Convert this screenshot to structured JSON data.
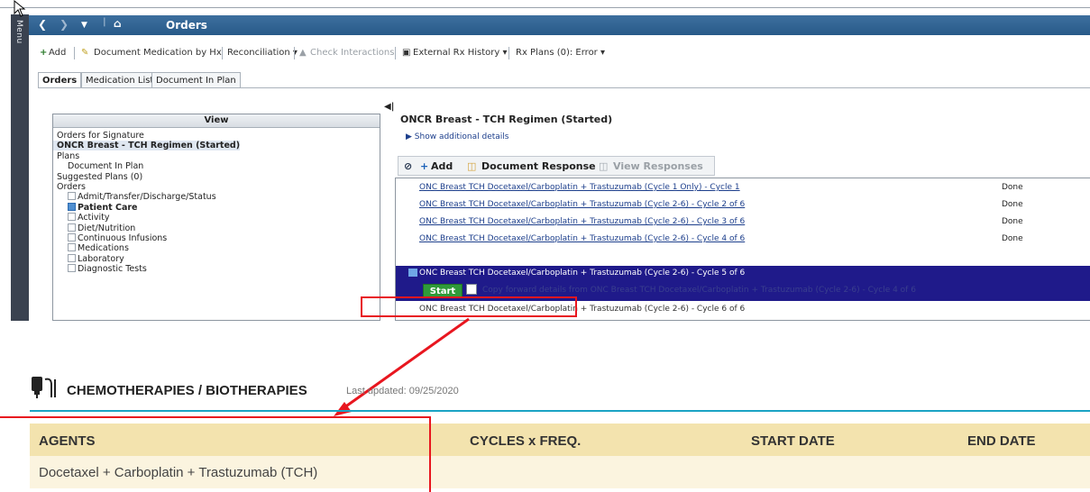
{
  "app": {
    "menu_label": "Menu",
    "window_title": "Orders",
    "toolbar": {
      "add": "Add",
      "document_medication": "Document Medication by Hx",
      "reconciliation": "Reconciliation ▾",
      "check_interactions": "Check Interactions",
      "external_rx": "External Rx History ▾",
      "rx_plans": "Rx Plans (0): Error ▾"
    },
    "tabs": [
      "Orders",
      "Medication List",
      "Document In Plan"
    ],
    "tree": {
      "header": "View",
      "items": [
        {
          "label": "Orders for Signature",
          "indent": 0,
          "bold": false,
          "checkbox": false
        },
        {
          "label": "ONCR Breast - TCH Regimen (Started)",
          "indent": 0,
          "bold": true,
          "checkbox": false
        },
        {
          "label": "Plans",
          "indent": 0,
          "bold": false,
          "checkbox": false
        },
        {
          "label": "Document In Plan",
          "indent": 1,
          "bold": false,
          "checkbox": false
        },
        {
          "label": "Suggested Plans (0)",
          "indent": 0,
          "bold": false,
          "checkbox": false
        },
        {
          "label": "Orders",
          "indent": 0,
          "bold": false,
          "checkbox": false
        },
        {
          "label": "Admit/Transfer/Discharge/Status",
          "indent": 1,
          "bold": false,
          "checkbox": true,
          "checked": false
        },
        {
          "label": "Patient Care",
          "indent": 1,
          "bold": true,
          "checkbox": true,
          "checked": true
        },
        {
          "label": "Activity",
          "indent": 1,
          "bold": false,
          "checkbox": true,
          "checked": false
        },
        {
          "label": "Diet/Nutrition",
          "indent": 1,
          "bold": false,
          "checkbox": true,
          "checked": false
        },
        {
          "label": "Continuous Infusions",
          "indent": 1,
          "bold": false,
          "checkbox": true,
          "checked": false
        },
        {
          "label": "Medications",
          "indent": 1,
          "bold": false,
          "checkbox": true,
          "checked": false
        },
        {
          "label": "Laboratory",
          "indent": 1,
          "bold": false,
          "checkbox": true,
          "checked": false
        },
        {
          "label": "Diagnostic Tests",
          "indent": 1,
          "bold": false,
          "checkbox": true,
          "checked": false
        }
      ]
    },
    "plan": {
      "title": "ONCR Breast - TCH Regimen (Started)",
      "show_details": "Show additional details",
      "toolbar_add": "Add",
      "toolbar_document_response": "Document Response",
      "toolbar_view_responses": "View Responses",
      "phases": [
        {
          "label": "ONC Breast TCH Docetaxel/Carboplatin + Trastuzumab (Cycle 1 Only) - Cycle 1",
          "status": "Done"
        },
        {
          "label": "ONC Breast TCH Docetaxel/Carboplatin + Trastuzumab (Cycle 2-6) - Cycle 2 of 6",
          "status": "Done"
        },
        {
          "label": "ONC Breast TCH Docetaxel/Carboplatin + Trastuzumab (Cycle 2-6) - Cycle 3 of 6",
          "status": "Done"
        },
        {
          "label": "ONC Breast TCH Docetaxel/Carboplatin + Trastuzumab (Cycle 2-6) - Cycle 4 of 6",
          "status": "Done"
        }
      ],
      "current_phase": "ONC Breast TCH Docetaxel/Carboplatin + Trastuzumab (Cycle 2-6) - Cycle 5 of 6",
      "start_label": "Start",
      "copy_text": "Copy forward details from ONC Breast TCH Docetaxel/Carboplatin + Trastuzumab (Cycle 2-6) - Cycle 4 of 6",
      "next_phase": "ONC Breast TCH Docetaxel/Carboplatin + Trastuzumab (Cycle 2-6) - Cycle 6 of 6"
    }
  },
  "summary": {
    "title": "CHEMOTHERAPIES / BIOTHERAPIES",
    "updated": "Last updated: 09/25/2020",
    "columns": [
      "AGENTS",
      "CYCLES x FREQ.",
      "START DATE",
      "END DATE"
    ],
    "rows": [
      [
        "Docetaxel + Carboplatin + Trastuzumab (TCH)",
        "",
        "",
        ""
      ]
    ]
  },
  "colors": {
    "annotation_red": "#e8161f",
    "selected_phase": "#1f1a8a",
    "header_band": "#f3e3ae"
  }
}
